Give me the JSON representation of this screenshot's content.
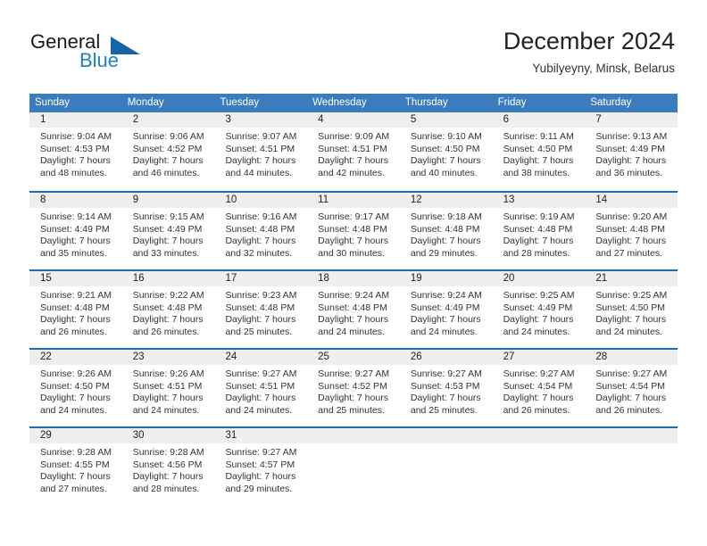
{
  "brand": {
    "word_one": "General",
    "word_two": "Blue",
    "logo_icon": "triangle-logo-icon"
  },
  "header": {
    "title": "December 2024",
    "location": "Yubilyeyny, Minsk, Belarus"
  },
  "calendar": {
    "weekday_headers": [
      "Sunday",
      "Monday",
      "Tuesday",
      "Wednesday",
      "Thursday",
      "Friday",
      "Saturday"
    ],
    "accent_color": "#3a7cbe",
    "rule_color": "#1f6cb0",
    "daynum_band_color": "#efefef",
    "weeks": [
      [
        {
          "day": "1",
          "sunrise": "Sunrise: 9:04 AM",
          "sunset": "Sunset: 4:53 PM",
          "daylight_line1": "Daylight: 7 hours",
          "daylight_line2": "and 48 minutes."
        },
        {
          "day": "2",
          "sunrise": "Sunrise: 9:06 AM",
          "sunset": "Sunset: 4:52 PM",
          "daylight_line1": "Daylight: 7 hours",
          "daylight_line2": "and 46 minutes."
        },
        {
          "day": "3",
          "sunrise": "Sunrise: 9:07 AM",
          "sunset": "Sunset: 4:51 PM",
          "daylight_line1": "Daylight: 7 hours",
          "daylight_line2": "and 44 minutes."
        },
        {
          "day": "4",
          "sunrise": "Sunrise: 9:09 AM",
          "sunset": "Sunset: 4:51 PM",
          "daylight_line1": "Daylight: 7 hours",
          "daylight_line2": "and 42 minutes."
        },
        {
          "day": "5",
          "sunrise": "Sunrise: 9:10 AM",
          "sunset": "Sunset: 4:50 PM",
          "daylight_line1": "Daylight: 7 hours",
          "daylight_line2": "and 40 minutes."
        },
        {
          "day": "6",
          "sunrise": "Sunrise: 9:11 AM",
          "sunset": "Sunset: 4:50 PM",
          "daylight_line1": "Daylight: 7 hours",
          "daylight_line2": "and 38 minutes."
        },
        {
          "day": "7",
          "sunrise": "Sunrise: 9:13 AM",
          "sunset": "Sunset: 4:49 PM",
          "daylight_line1": "Daylight: 7 hours",
          "daylight_line2": "and 36 minutes."
        }
      ],
      [
        {
          "day": "8",
          "sunrise": "Sunrise: 9:14 AM",
          "sunset": "Sunset: 4:49 PM",
          "daylight_line1": "Daylight: 7 hours",
          "daylight_line2": "and 35 minutes."
        },
        {
          "day": "9",
          "sunrise": "Sunrise: 9:15 AM",
          "sunset": "Sunset: 4:49 PM",
          "daylight_line1": "Daylight: 7 hours",
          "daylight_line2": "and 33 minutes."
        },
        {
          "day": "10",
          "sunrise": "Sunrise: 9:16 AM",
          "sunset": "Sunset: 4:48 PM",
          "daylight_line1": "Daylight: 7 hours",
          "daylight_line2": "and 32 minutes."
        },
        {
          "day": "11",
          "sunrise": "Sunrise: 9:17 AM",
          "sunset": "Sunset: 4:48 PM",
          "daylight_line1": "Daylight: 7 hours",
          "daylight_line2": "and 30 minutes."
        },
        {
          "day": "12",
          "sunrise": "Sunrise: 9:18 AM",
          "sunset": "Sunset: 4:48 PM",
          "daylight_line1": "Daylight: 7 hours",
          "daylight_line2": "and 29 minutes."
        },
        {
          "day": "13",
          "sunrise": "Sunrise: 9:19 AM",
          "sunset": "Sunset: 4:48 PM",
          "daylight_line1": "Daylight: 7 hours",
          "daylight_line2": "and 28 minutes."
        },
        {
          "day": "14",
          "sunrise": "Sunrise: 9:20 AM",
          "sunset": "Sunset: 4:48 PM",
          "daylight_line1": "Daylight: 7 hours",
          "daylight_line2": "and 27 minutes."
        }
      ],
      [
        {
          "day": "15",
          "sunrise": "Sunrise: 9:21 AM",
          "sunset": "Sunset: 4:48 PM",
          "daylight_line1": "Daylight: 7 hours",
          "daylight_line2": "and 26 minutes."
        },
        {
          "day": "16",
          "sunrise": "Sunrise: 9:22 AM",
          "sunset": "Sunset: 4:48 PM",
          "daylight_line1": "Daylight: 7 hours",
          "daylight_line2": "and 26 minutes."
        },
        {
          "day": "17",
          "sunrise": "Sunrise: 9:23 AM",
          "sunset": "Sunset: 4:48 PM",
          "daylight_line1": "Daylight: 7 hours",
          "daylight_line2": "and 25 minutes."
        },
        {
          "day": "18",
          "sunrise": "Sunrise: 9:24 AM",
          "sunset": "Sunset: 4:48 PM",
          "daylight_line1": "Daylight: 7 hours",
          "daylight_line2": "and 24 minutes."
        },
        {
          "day": "19",
          "sunrise": "Sunrise: 9:24 AM",
          "sunset": "Sunset: 4:49 PM",
          "daylight_line1": "Daylight: 7 hours",
          "daylight_line2": "and 24 minutes."
        },
        {
          "day": "20",
          "sunrise": "Sunrise: 9:25 AM",
          "sunset": "Sunset: 4:49 PM",
          "daylight_line1": "Daylight: 7 hours",
          "daylight_line2": "and 24 minutes."
        },
        {
          "day": "21",
          "sunrise": "Sunrise: 9:25 AM",
          "sunset": "Sunset: 4:50 PM",
          "daylight_line1": "Daylight: 7 hours",
          "daylight_line2": "and 24 minutes."
        }
      ],
      [
        {
          "day": "22",
          "sunrise": "Sunrise: 9:26 AM",
          "sunset": "Sunset: 4:50 PM",
          "daylight_line1": "Daylight: 7 hours",
          "daylight_line2": "and 24 minutes."
        },
        {
          "day": "23",
          "sunrise": "Sunrise: 9:26 AM",
          "sunset": "Sunset: 4:51 PM",
          "daylight_line1": "Daylight: 7 hours",
          "daylight_line2": "and 24 minutes."
        },
        {
          "day": "24",
          "sunrise": "Sunrise: 9:27 AM",
          "sunset": "Sunset: 4:51 PM",
          "daylight_line1": "Daylight: 7 hours",
          "daylight_line2": "and 24 minutes."
        },
        {
          "day": "25",
          "sunrise": "Sunrise: 9:27 AM",
          "sunset": "Sunset: 4:52 PM",
          "daylight_line1": "Daylight: 7 hours",
          "daylight_line2": "and 25 minutes."
        },
        {
          "day": "26",
          "sunrise": "Sunrise: 9:27 AM",
          "sunset": "Sunset: 4:53 PM",
          "daylight_line1": "Daylight: 7 hours",
          "daylight_line2": "and 25 minutes."
        },
        {
          "day": "27",
          "sunrise": "Sunrise: 9:27 AM",
          "sunset": "Sunset: 4:54 PM",
          "daylight_line1": "Daylight: 7 hours",
          "daylight_line2": "and 26 minutes."
        },
        {
          "day": "28",
          "sunrise": "Sunrise: 9:27 AM",
          "sunset": "Sunset: 4:54 PM",
          "daylight_line1": "Daylight: 7 hours",
          "daylight_line2": "and 26 minutes."
        }
      ],
      [
        {
          "day": "29",
          "sunrise": "Sunrise: 9:28 AM",
          "sunset": "Sunset: 4:55 PM",
          "daylight_line1": "Daylight: 7 hours",
          "daylight_line2": "and 27 minutes."
        },
        {
          "day": "30",
          "sunrise": "Sunrise: 9:28 AM",
          "sunset": "Sunset: 4:56 PM",
          "daylight_line1": "Daylight: 7 hours",
          "daylight_line2": "and 28 minutes."
        },
        {
          "day": "31",
          "sunrise": "Sunrise: 9:27 AM",
          "sunset": "Sunset: 4:57 PM",
          "daylight_line1": "Daylight: 7 hours",
          "daylight_line2": "and 29 minutes."
        },
        {
          "day": "",
          "sunrise": "",
          "sunset": "",
          "daylight_line1": "",
          "daylight_line2": ""
        },
        {
          "day": "",
          "sunrise": "",
          "sunset": "",
          "daylight_line1": "",
          "daylight_line2": ""
        },
        {
          "day": "",
          "sunrise": "",
          "sunset": "",
          "daylight_line1": "",
          "daylight_line2": ""
        },
        {
          "day": "",
          "sunrise": "",
          "sunset": "",
          "daylight_line1": "",
          "daylight_line2": ""
        }
      ]
    ]
  }
}
